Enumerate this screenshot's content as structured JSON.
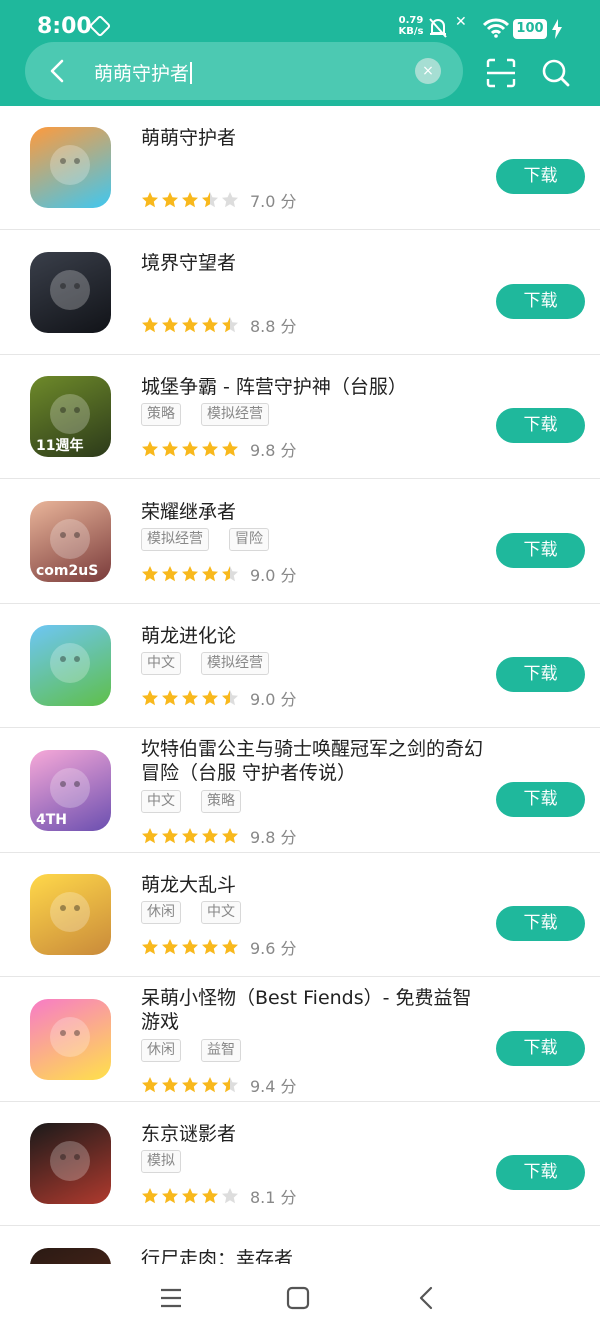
{
  "status_bar": {
    "time": "8:00",
    "net_speed_value": "0.79",
    "net_speed_unit": "KB/s",
    "battery": "100"
  },
  "search": {
    "query": "萌萌守护者",
    "clear_label": "×"
  },
  "list": {
    "download_label": "下载",
    "score_unit": "分",
    "items": [
      {
        "title": "萌萌守护者",
        "tags": [],
        "rating": 3.5,
        "score": "7.0",
        "icon_colors": [
          "#ff9a3c",
          "#3fc7f0"
        ]
      },
      {
        "title": "境界守望者",
        "tags": [],
        "rating": 4.5,
        "score": "8.8",
        "icon_colors": [
          "#3a3f4a",
          "#111318"
        ]
      },
      {
        "title": "城堡争霸 - 阵营守护神（台服）",
        "tags": [
          "策略",
          "模拟经营"
        ],
        "rating": 5,
        "score": "9.8",
        "icon_colors": [
          "#6e8a2a",
          "#2c3a1a"
        ],
        "icon_text": "11週年"
      },
      {
        "title": "荣耀继承者",
        "tags": [
          "模拟经营",
          "冒险"
        ],
        "rating": 4.5,
        "score": "9.0",
        "icon_colors": [
          "#e9b59a",
          "#7a3b3b"
        ],
        "icon_text": "com2uS"
      },
      {
        "title": "萌龙进化论",
        "tags": [
          "中文",
          "模拟经营"
        ],
        "rating": 4.5,
        "score": "9.0",
        "icon_colors": [
          "#6ec6f5",
          "#5fbf4a"
        ]
      },
      {
        "title": "坎特伯雷公主与骑士唤醒冠军之剑的奇幻冒险（台服 守护者传说）",
        "tags": [
          "中文",
          "策略"
        ],
        "rating": 5,
        "score": "9.8",
        "icon_colors": [
          "#f7a9d8",
          "#6b4fb0"
        ],
        "icon_text": "4TH"
      },
      {
        "title": "萌龙大乱斗",
        "tags": [
          "休闲",
          "中文"
        ],
        "rating": 5,
        "score": "9.6",
        "icon_colors": [
          "#ffd84a",
          "#c98a3a"
        ]
      },
      {
        "title": "呆萌小怪物（Best Fiends）- 免费益智游戏",
        "tags": [
          "休闲",
          "益智"
        ],
        "rating": 4.5,
        "score": "9.4",
        "icon_colors": [
          "#f77bc7",
          "#ffe14a"
        ]
      },
      {
        "title": "东京谜影者",
        "tags": [
          "模拟"
        ],
        "rating": 4,
        "score": "8.1",
        "icon_colors": [
          "#1a1a1a",
          "#b03a2e"
        ]
      },
      {
        "title": "行尸走肉：幸存者",
        "tags": [],
        "rating": 0,
        "score": "",
        "icon_colors": [
          "#2a1a14",
          "#5a2a1a"
        ]
      }
    ]
  },
  "colors": {
    "accent": "#1fb89c",
    "star": "#f8b81c",
    "star_empty": "#dddddd"
  },
  "icons": [
    "back-icon",
    "clear-icon",
    "scan-icon",
    "search-icon",
    "menu-icon",
    "home-icon",
    "nav-back-icon"
  ]
}
